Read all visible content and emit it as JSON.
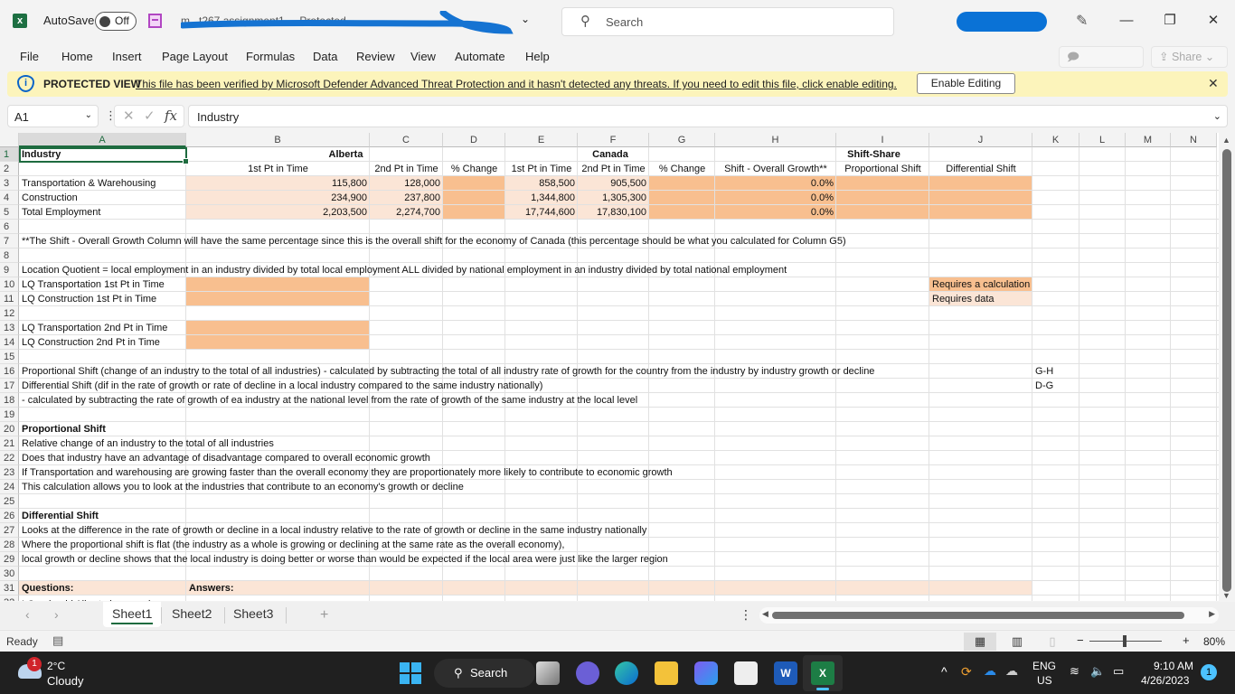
{
  "titlebar": {
    "app_icon": "excel-icon",
    "autosave_label": "AutoSave",
    "autosave_state": "Off",
    "filename": "m...t267 assignment1 ... Protected...",
    "search_placeholder": "Search",
    "window_controls": [
      "minimize",
      "restore",
      "close"
    ]
  },
  "menu": {
    "items": [
      "File",
      "Home",
      "Insert",
      "Page Layout",
      "Formulas",
      "Data",
      "Review",
      "View",
      "Automate",
      "Help"
    ],
    "comments_label": "Comments",
    "share_label": "Share"
  },
  "protected_view": {
    "title": "PROTECTED VIEW",
    "message": "This file has been verified by Microsoft Defender Advanced Threat Protection and it hasn't detected any threats. If you need to edit this file, click enable editing.",
    "enable_button": "Enable Editing"
  },
  "formula_bar": {
    "name_box": "A1",
    "fx_label": "fx",
    "value": "Industry"
  },
  "grid": {
    "columns": [
      "A",
      "B",
      "C",
      "D",
      "E",
      "F",
      "G",
      "H",
      "I",
      "J",
      "K",
      "L",
      "M",
      "N"
    ],
    "rows": [
      "1",
      "2",
      "3",
      "4",
      "5",
      "6",
      "7",
      "8",
      "9",
      "10",
      "11",
      "12",
      "13",
      "14",
      "15",
      "16",
      "17",
      "18",
      "19",
      "20",
      "21",
      "22",
      "23",
      "24",
      "25",
      "26",
      "27",
      "28",
      "29",
      "30",
      "31"
    ],
    "cells": {
      "A1": "Industry",
      "B1": "Alberta",
      "E1": "Canada",
      "H1": "Shift-Share",
      "B2": "1st Pt in Time",
      "C2": "2nd Pt in Time",
      "D2": "% Change",
      "E2": "1st Pt in Time",
      "F2": "2nd Pt in Time",
      "G2": "% Change",
      "H2": "Shift - Overall Growth**",
      "I2": "Proportional Shift",
      "J2": "Differential Shift",
      "A3": "Transportation & Warehousing",
      "B3": "115,800",
      "C3": "128,000",
      "E3": "858,500",
      "F3": "905,500",
      "H3": "0.0%",
      "A4": "Construction",
      "B4": "234,900",
      "C4": "237,800",
      "E4": "1,344,800",
      "F4": "1,305,300",
      "H4": "0.0%",
      "A5": "Total Employment",
      "B5": "2,203,500",
      "C5": "2,274,700",
      "E5": "17,744,600",
      "F5": "17,830,100",
      "H5": "0.0%",
      "A7": "**The Shift - Overall Growth Column will have the same percentage since this is the overall shift for the economy of Canada (this percentage should be what you calculated for Column G5)",
      "A9": "Location Quotient = local employment in an industry divided by total local employment ALL divided by national employment in an industry divided by total national employment",
      "A10": "LQ Transportation 1st Pt in Time",
      "J10": "Requires a calculation",
      "A11": "LQ Construction  1st Pt in Time",
      "J11": "Requires data",
      "A13": "LQ Transportation 2nd Pt in Time",
      "A14": "LQ Construction 2nd Pt in Time",
      "A16": "Proportional Shift (change of an industry to the total of all industries) - calculated by subtracting the total of all industry rate of growth for the country from the industry by industry growth or decline",
      "K16": "G-H",
      "A17": "Differential Shift (dif in the rate of growth or rate of decline in a local industry compared to the same industry nationally)",
      "K17": "D-G",
      "A18": " -  calculated by subtracting the rate of growth of ea industry at the national level from the rate of growth of the same industry at the local level",
      "A20": "Proportional Shift",
      "A21": "Relative change of an industry to the total of all industries",
      "A22": "Does that industry have an advantage of disadvantage compared to overall economic growth",
      "A23": "If Transportation and warehousing are growing faster than the overall economy they are proportionately more likely to contribute to economic growth",
      "A24": "This calculation allows you to look at the industries that contribute to an economy's growth or decline",
      "A26": "Differential Shift",
      "A27": "Looks at the difference in the rate of growth or decline in a local industry relative to the rate of growth or decline in the same industry nationally",
      "A28": "Where the proportional shift is flat (the industry as a whole is growing or declining at the same rate as the overall economy),",
      "A29": "local growth or decline shows that the local industry is doing better or worse  than would be expected if the local area were just like the larger region",
      "A31": "Questions:",
      "B31": "Answers:",
      "A32": "LQ - should Alberta be pursuing"
    },
    "colors": {
      "requires_data": "#fbe5d6",
      "requires_calculation": "#f8bf8f",
      "selection": "#1e6b3f"
    }
  },
  "sheets": {
    "tabs": [
      "Sheet1",
      "Sheet2",
      "Sheet3"
    ],
    "active": "Sheet1",
    "add_label": "+"
  },
  "status": {
    "ready": "Ready",
    "zoom": "80%",
    "zoom_minus": "−",
    "zoom_plus": "+"
  },
  "taskbar": {
    "weather_temp": "2°C",
    "weather_desc": "Cloudy",
    "weather_badge": "1",
    "search_label": "Search",
    "lang_top": "ENG",
    "lang_bottom": "US",
    "time": "9:10 AM",
    "date": "4/26/2023",
    "notification_count": "1"
  }
}
